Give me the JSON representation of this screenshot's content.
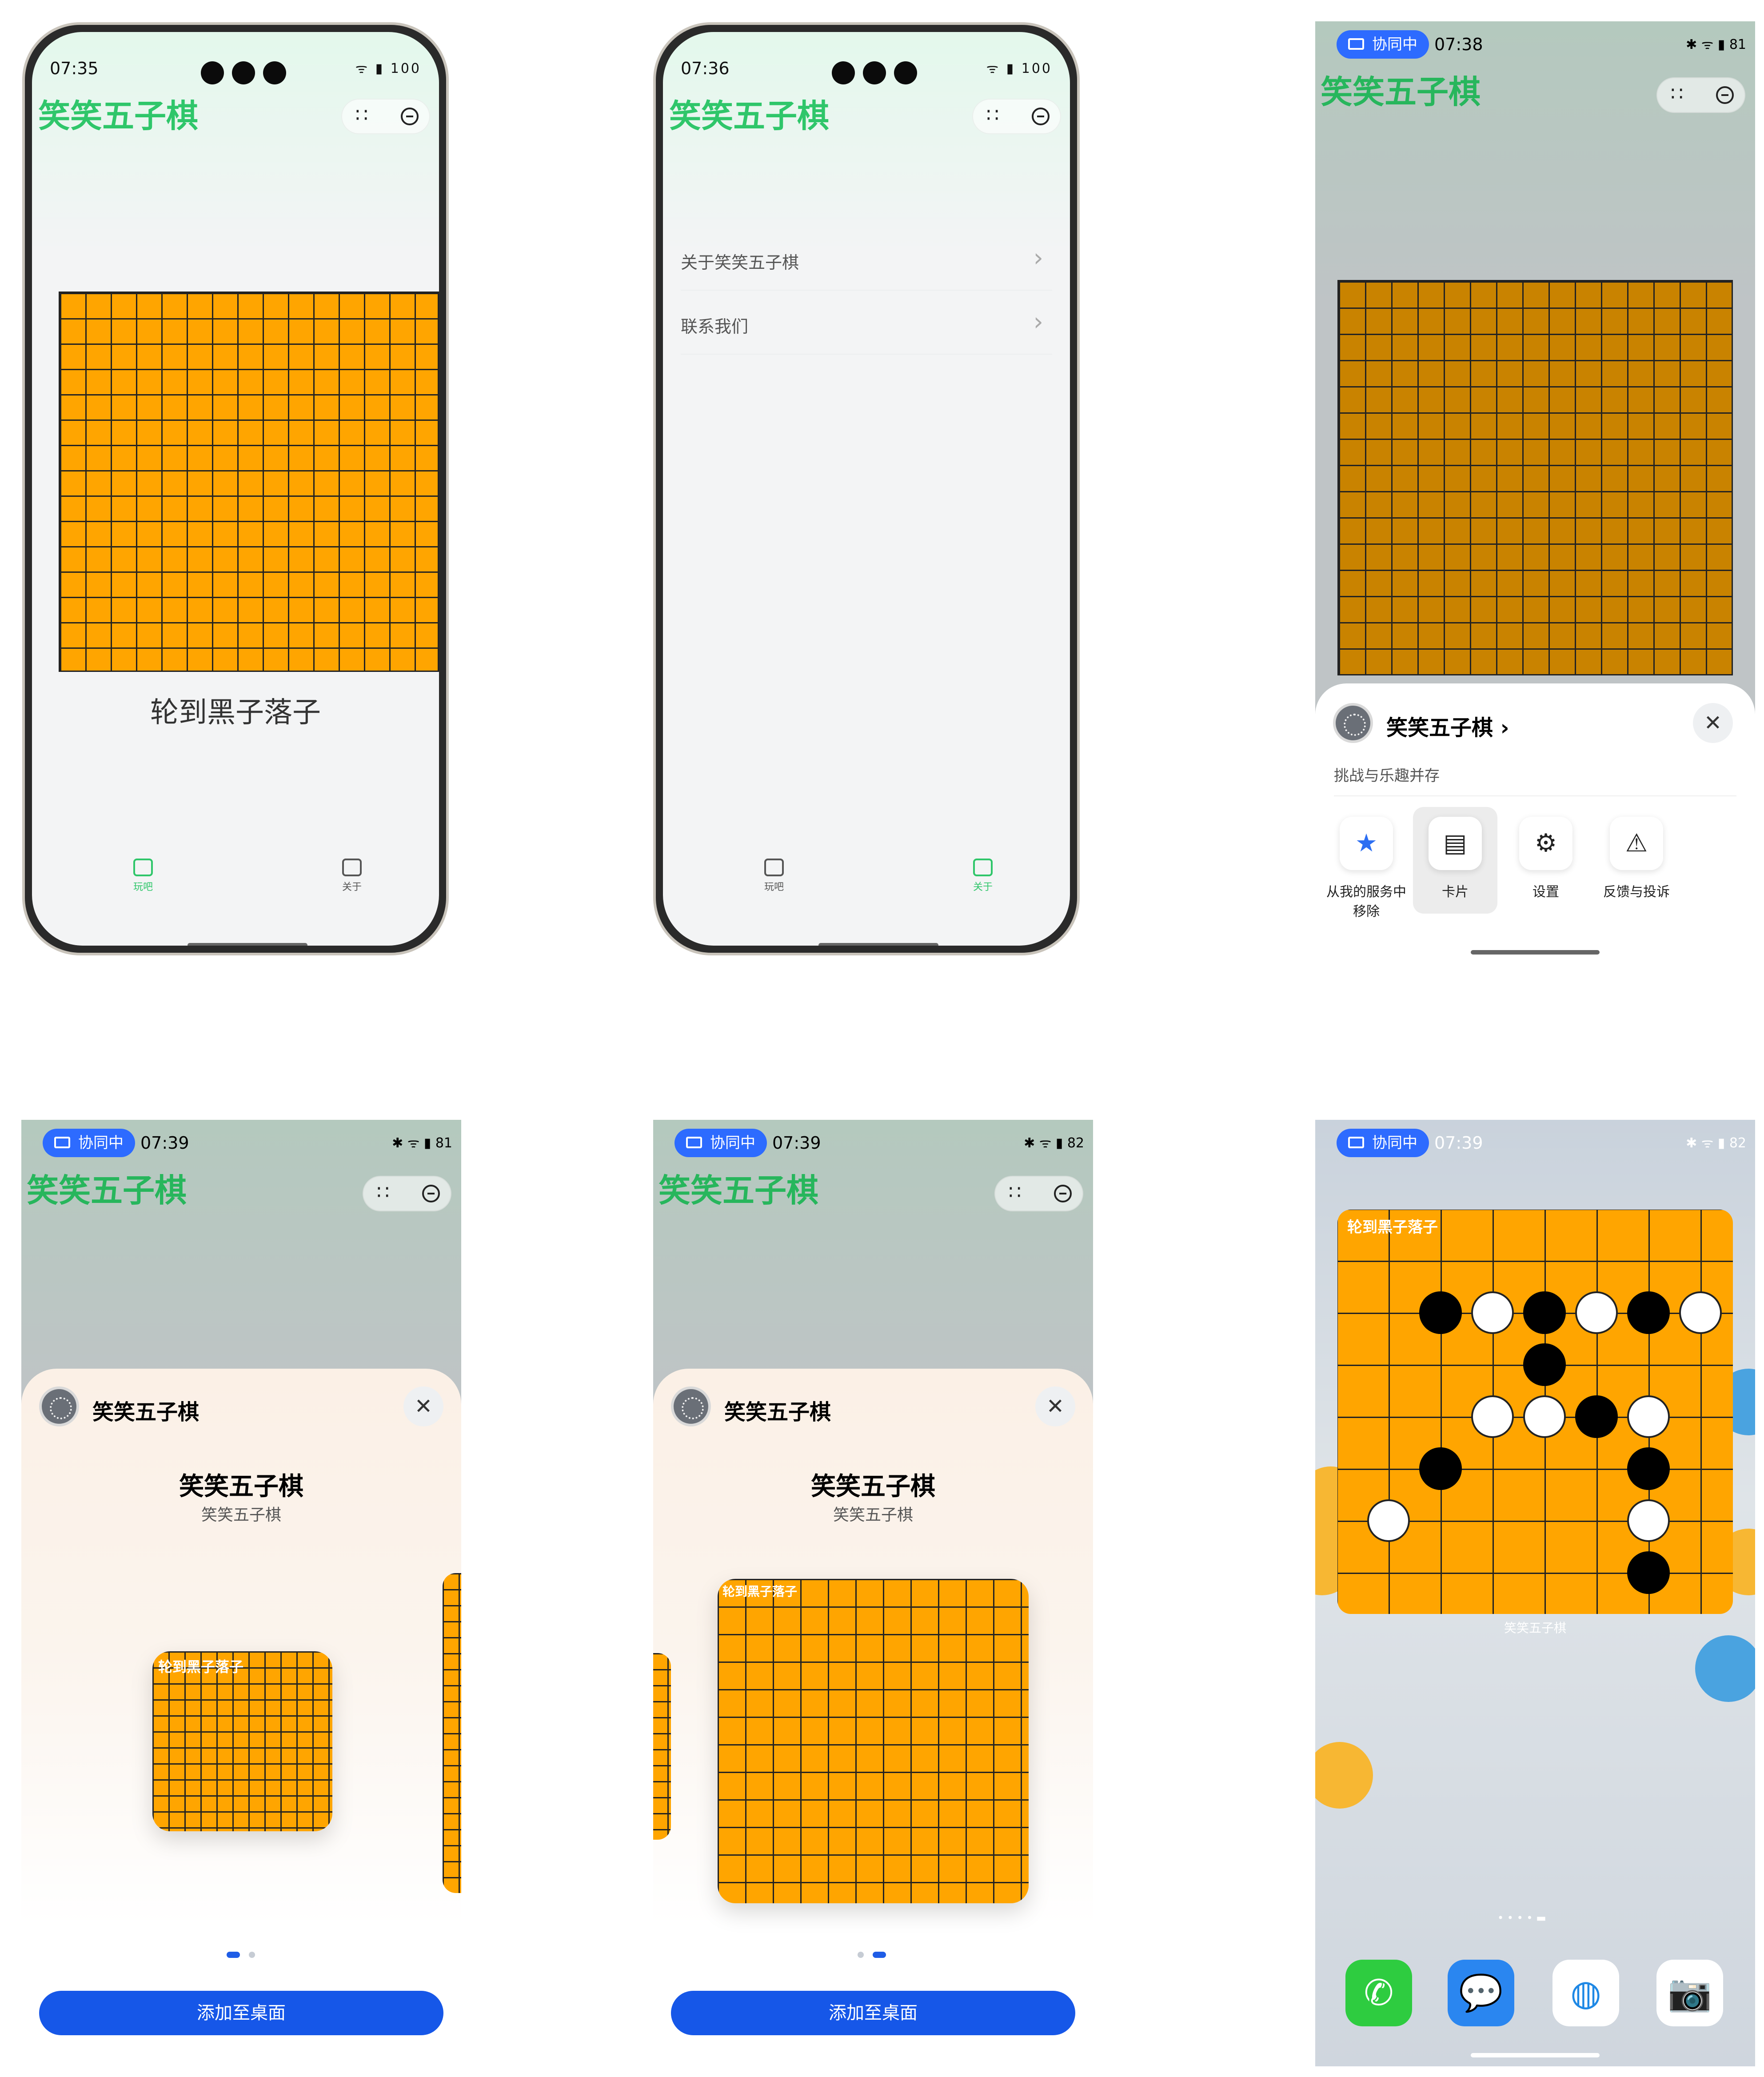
{
  "screens": {
    "s1": {
      "time": "07:35",
      "battery": "100",
      "title": "笑笑五子棋",
      "turn": "轮到黑子落子",
      "tab_play": "玩吧",
      "tab_about": "关于"
    },
    "s2": {
      "time": "07:36",
      "battery": "100",
      "title": "笑笑五子棋",
      "row1": "关于笑笑五子棋",
      "row2": "联系我们",
      "tab_play": "玩吧",
      "tab_about": "关于"
    },
    "s3": {
      "badge": "协同中",
      "time": "07:38",
      "battery": "81",
      "title": "笑笑五子棋",
      "sheet_title": "笑笑五子棋 ›",
      "sheet_sub": "挑战与乐趣并存",
      "act1": "从我的服务中移除",
      "act2": "卡片",
      "act3": "设置",
      "act4": "反馈与投诉"
    },
    "s4": {
      "badge": "协同中",
      "time": "07:39",
      "battery": "81",
      "title": "笑笑五子棋",
      "sheet_name": "笑笑五子棋",
      "card_title": "笑笑五子棋",
      "card_sub": "笑笑五子棋",
      "widget_label": "轮到黑子落子",
      "button": "添加至桌面"
    },
    "s5": {
      "badge": "协同中",
      "time": "07:39",
      "battery": "82",
      "title": "笑笑五子棋",
      "sheet_name": "笑笑五子棋",
      "card_title": "笑笑五子棋",
      "card_sub": "笑笑五子棋",
      "widget_label": "轮到黑子落子",
      "button": "添加至桌面"
    },
    "s6": {
      "badge": "协同中",
      "time": "07:39",
      "battery": "82",
      "widget_label": "轮到黑子落子",
      "widget_caption": "笑笑五子棋",
      "dock": [
        "phone-icon",
        "messages-icon",
        "browser-icon",
        "camera-icon"
      ]
    }
  },
  "colors": {
    "accent": "#2fc66a",
    "board": "#ffa500",
    "board_dark": "#c98300",
    "button": "#1657e8"
  },
  "board6_stones": [
    {
      "r": 1,
      "c": 1,
      "color": "b"
    },
    {
      "r": 1,
      "c": 2,
      "color": "w"
    },
    {
      "r": 1,
      "c": 3,
      "color": "b"
    },
    {
      "r": 1,
      "c": 4,
      "color": "w"
    },
    {
      "r": 1,
      "c": 5,
      "color": "b"
    },
    {
      "r": 1,
      "c": 6,
      "color": "w"
    },
    {
      "r": 2,
      "c": 3,
      "color": "b"
    },
    {
      "r": 3,
      "c": 2,
      "color": "w"
    },
    {
      "r": 3,
      "c": 3,
      "color": "w"
    },
    {
      "r": 3,
      "c": 4,
      "color": "b"
    },
    {
      "r": 3,
      "c": 5,
      "color": "w"
    },
    {
      "r": 4,
      "c": 1,
      "color": "b"
    },
    {
      "r": 4,
      "c": 5,
      "color": "b"
    },
    {
      "r": 5,
      "c": 0,
      "color": "w"
    },
    {
      "r": 5,
      "c": 5,
      "color": "w"
    },
    {
      "r": 6,
      "c": 5,
      "color": "b"
    }
  ]
}
